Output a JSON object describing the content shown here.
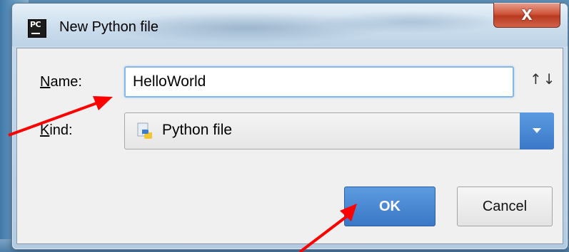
{
  "window": {
    "app_icon_text": "PC",
    "title": "New Python file",
    "close_label": "X"
  },
  "form": {
    "name_label_mnemonic": "N",
    "name_label_rest": "ame:",
    "name_value": "HelloWorld",
    "sort_icon": "↑↓",
    "kind_label_mnemonic": "K",
    "kind_label_rest": "ind:",
    "kind_value": "Python file",
    "kind_icon": "python-file-icon"
  },
  "buttons": {
    "ok_label": "OK",
    "cancel_label": "Cancel"
  },
  "colors": {
    "accent": "#3b78c8",
    "annotation_arrow": "#ff0000",
    "close_button": "#c9472b"
  }
}
